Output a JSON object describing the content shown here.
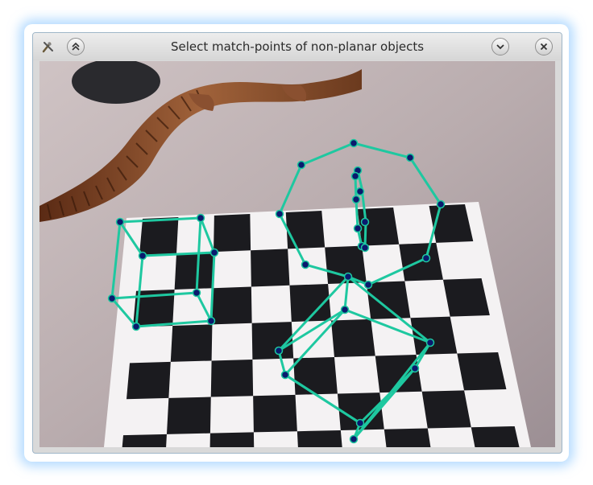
{
  "window": {
    "title": "Select match-points of non-planar objects",
    "buttons": [
      {
        "name": "shade-button",
        "icon": "double-chevron-up-icon"
      },
      {
        "name": "minimize-button",
        "icon": "chevron-down-icon"
      },
      {
        "name": "close-button",
        "icon": "close-x-icon"
      }
    ],
    "app_icon": "tools-icon"
  },
  "colors": {
    "overlay_line": "#1ec8a0",
    "point_fill": "#0a1a6e",
    "point_stroke": "#1ec8a0"
  }
}
